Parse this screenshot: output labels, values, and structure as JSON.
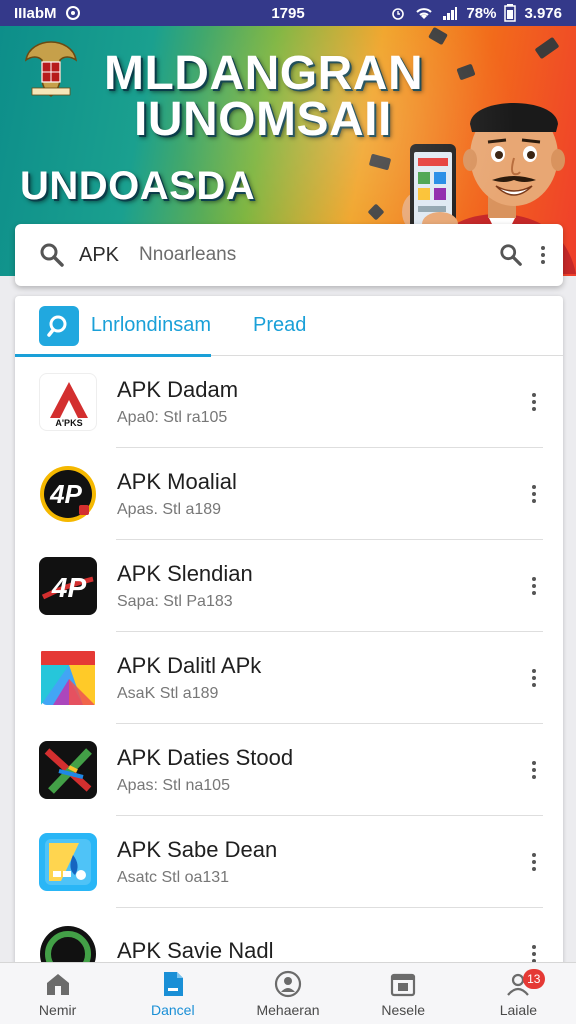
{
  "status_bar": {
    "carrier": "IIIabM",
    "time": "1795",
    "battery_text": "78%",
    "extra": "3.976"
  },
  "banner": {
    "line1": "MLDANGRAN",
    "line2": "IUNOMSAII",
    "line3": "UNDOASDA"
  },
  "search": {
    "value": "APK",
    "placeholder": "Nnoarleans"
  },
  "tabs": [
    {
      "label": "Lnrlondinsam",
      "active": true
    },
    {
      "label": "Pread",
      "active": false
    }
  ],
  "apps": [
    {
      "title": "APK Dadam",
      "subtitle": "Apa0: Stl ra105",
      "icon": "red-a-logo-icon"
    },
    {
      "title": "APK Moalial",
      "subtitle": "Apas. Stl a189",
      "icon": "4p-circle-logo-icon"
    },
    {
      "title": "APK Slendian",
      "subtitle": "Sapa: Stl Pa183",
      "icon": "4p-black-logo-icon"
    },
    {
      "title": "APK Dalitl APk",
      "subtitle": "AsaK Stl a189",
      "icon": "colorful-tiles-icon"
    },
    {
      "title": "APK Daties Stood",
      "subtitle": "Apas: Stl na105",
      "icon": "green-x-logo-icon"
    },
    {
      "title": "APK Sabe Dean",
      "subtitle": "Asatc Stl oa131",
      "icon": "blue-yellow-app-icon"
    },
    {
      "title": "APK Savie Nadl",
      "subtitle": "",
      "icon": "green-circle-logo-icon"
    }
  ],
  "bottom_nav": [
    {
      "label": "Nemir",
      "icon": "home-icon",
      "active": false
    },
    {
      "label": "Dancel",
      "icon": "document-icon",
      "active": true
    },
    {
      "label": "Mehaeran",
      "icon": "user-circle-icon",
      "active": false
    },
    {
      "label": "Nesele",
      "icon": "calendar-icon",
      "active": false
    },
    {
      "label": "Laiale",
      "icon": "profile-icon",
      "active": false,
      "badge": "13"
    }
  ],
  "colors": {
    "status_bar": "#34398a",
    "accent": "#1aa0d8",
    "badge": "#e53935"
  }
}
